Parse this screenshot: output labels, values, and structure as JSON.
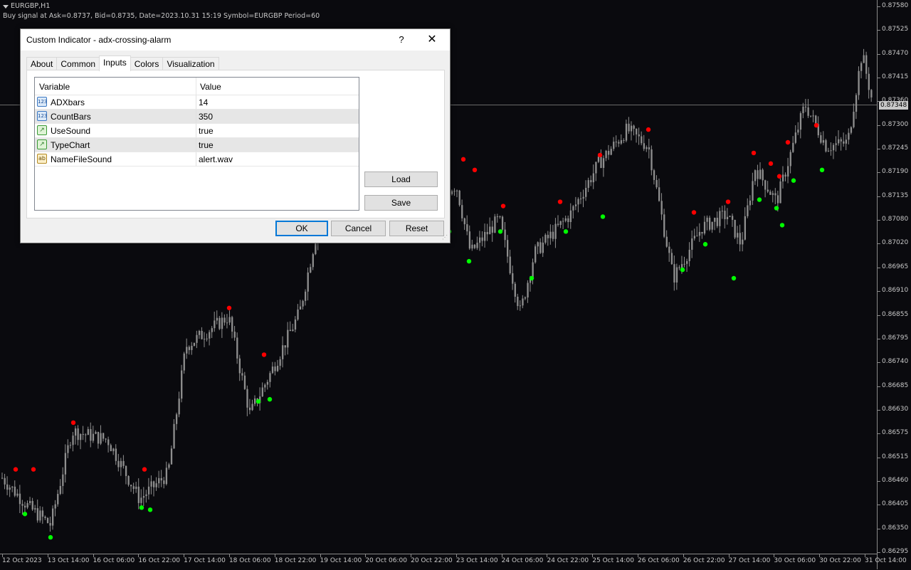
{
  "chart_header": {
    "symbol": "EURGBP,H1",
    "signal_text": "Buy signal at Ask=0.8737, Bid=0.8735, Date=2023.10.31 15:19 Symbol=EURGBP Period=60"
  },
  "colors": {
    "background": "#0a0a0e",
    "candle": "#8f8f8f",
    "sell_dot": "#ff0000",
    "buy_dot": "#00ff00",
    "axis_text": "#c8c8c8",
    "dialog_default_border": "#0078d7"
  },
  "price_axis": {
    "labels": [
      "0.87580",
      "0.87525",
      "0.87470",
      "0.87415",
      "0.87360",
      "0.87300",
      "0.87245",
      "0.87190",
      "0.87135",
      "0.87080",
      "0.87020",
      "0.86965",
      "0.86910",
      "0.86855",
      "0.86795",
      "0.86740",
      "0.86685",
      "0.86630",
      "0.86575",
      "0.86515",
      "0.86460",
      "0.86405",
      "0.86350",
      "0.86295"
    ],
    "current_price": "0.87348"
  },
  "time_axis": {
    "labels": [
      "12 Oct 2023",
      "13 Oct 14:00",
      "16 Oct 06:00",
      "16 Oct 22:00",
      "17 Oct 14:00",
      "18 Oct 06:00",
      "18 Oct 22:00",
      "19 Oct 14:00",
      "20 Oct 06:00",
      "20 Oct 22:00",
      "23 Oct 14:00",
      "24 Oct 06:00",
      "24 Oct 22:00",
      "25 Oct 14:00",
      "26 Oct 06:00",
      "26 Oct 22:00",
      "27 Oct 14:00",
      "30 Oct 06:00",
      "30 Oct 22:00",
      "31 Oct 14:00"
    ]
  },
  "chart_data": {
    "type": "candlestick",
    "symbol": "EURGBP",
    "timeframe": "H1",
    "ylim": [
      0.86295,
      0.8758
    ],
    "current_price": 0.87348,
    "sell_signals": [
      {
        "near": "12 Oct 2023",
        "price": 0.8649
      },
      {
        "near": "13 Oct",
        "price": 0.8649
      },
      {
        "near": "16 Oct 06:00",
        "price": 0.866
      },
      {
        "near": "16 Oct 22:00",
        "price": 0.8649
      },
      {
        "near": "17 Oct 14:00",
        "price": 0.8687
      },
      {
        "near": "18 Oct 06:00",
        "price": 0.8676
      },
      {
        "near": "23 Oct",
        "price": 0.8722
      },
      {
        "near": "23 Oct 14:00",
        "price": 0.87195
      },
      {
        "near": "24 Oct 06:00",
        "price": 0.8711
      },
      {
        "near": "24 Oct 22:00",
        "price": 0.8712
      },
      {
        "near": "25 Oct 14:00",
        "price": 0.8723
      },
      {
        "near": "26 Oct 06:00",
        "price": 0.8729
      },
      {
        "near": "26 Oct 22:00",
        "price": 0.87095
      },
      {
        "near": "27 Oct 14:00",
        "price": 0.8712
      },
      {
        "near": "27 Oct 14:00",
        "price": 0.87235
      },
      {
        "near": "27 Oct 14:00",
        "price": 0.8721
      },
      {
        "near": "30 Oct 06:00",
        "price": 0.8718
      },
      {
        "near": "30 Oct 06:00",
        "price": 0.8726
      },
      {
        "near": "30 Oct 22:00",
        "price": 0.873
      }
    ],
    "buy_signals": [
      {
        "near": "12 Oct 2023",
        "price": 0.86385
      },
      {
        "near": "13 Oct",
        "price": 0.8633
      },
      {
        "near": "16 Oct 22:00",
        "price": 0.864
      },
      {
        "near": "16 Oct 22:00",
        "price": 0.86395
      },
      {
        "near": "18 Oct 06:00",
        "price": 0.8665
      },
      {
        "near": "18 Oct 06:00",
        "price": 0.86655
      },
      {
        "near": "20 Oct 22:00",
        "price": 0.8705
      },
      {
        "near": "23 Oct 14:00",
        "price": 0.8698
      },
      {
        "near": "24 Oct 06:00",
        "price": 0.8705
      },
      {
        "near": "24 Oct 06:00",
        "price": 0.8694
      },
      {
        "near": "24 Oct 22:00",
        "price": 0.8705
      },
      {
        "near": "25 Oct 14:00",
        "price": 0.87085
      },
      {
        "near": "26 Oct 06:00",
        "price": 0.8696
      },
      {
        "near": "26 Oct 22:00",
        "price": 0.8702
      },
      {
        "near": "27 Oct 14:00",
        "price": 0.8694
      },
      {
        "near": "27 Oct 14:00",
        "price": 0.87125
      },
      {
        "near": "30 Oct 06:00",
        "price": 0.87105
      },
      {
        "near": "30 Oct 06:00",
        "price": 0.87065
      },
      {
        "near": "30 Oct 06:00",
        "price": 0.8717
      },
      {
        "near": "30 Oct 22:00",
        "price": 0.87195
      }
    ]
  },
  "dialog": {
    "title": "Custom Indicator - adx-crossing-alarm",
    "help_label": "?",
    "close_label": "✕",
    "tabs": [
      {
        "label": "About"
      },
      {
        "label": "Common"
      },
      {
        "label": "Inputs"
      },
      {
        "label": "Colors"
      },
      {
        "label": "Visualization"
      }
    ],
    "active_tab": "Inputs",
    "grid": {
      "headers": {
        "variable": "Variable",
        "value": "Value"
      },
      "rows": [
        {
          "icon": "123",
          "icon_type": "numeric-icon",
          "variable": "ADXbars",
          "value": "14"
        },
        {
          "icon": "123",
          "icon_type": "numeric-icon",
          "variable": "CountBars",
          "value": "350"
        },
        {
          "icon": "↗",
          "icon_type": "boolean-icon",
          "variable": "UseSound",
          "value": "true"
        },
        {
          "icon": "↗",
          "icon_type": "boolean-icon",
          "variable": "TypeChart",
          "value": "true"
        },
        {
          "icon": "ab",
          "icon_type": "string-icon",
          "variable": "NameFileSound",
          "value": "alert.wav"
        }
      ]
    },
    "buttons": {
      "load": "Load",
      "save": "Save",
      "ok": "OK",
      "cancel": "Cancel",
      "reset": "Reset"
    }
  }
}
